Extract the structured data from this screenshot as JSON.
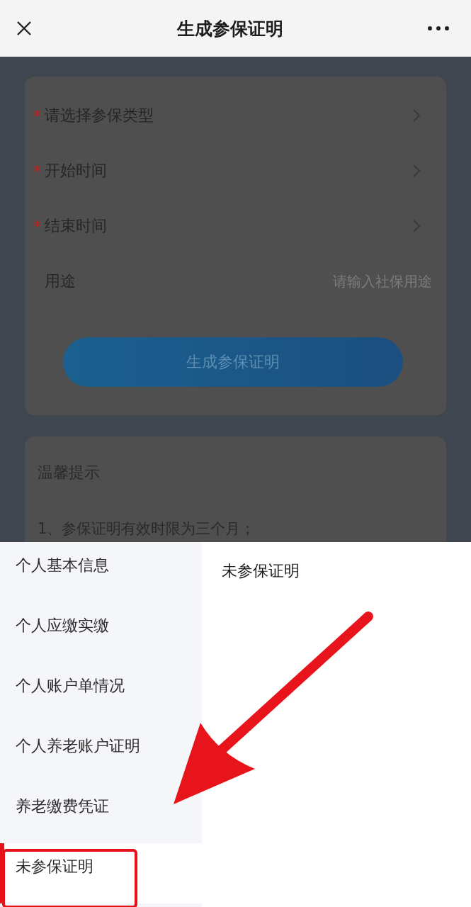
{
  "header": {
    "title": "生成参保证明"
  },
  "form": {
    "rows": [
      {
        "kind": "select",
        "marker": "*",
        "label": "请选择参保类型"
      },
      {
        "kind": "select",
        "marker": "*",
        "label": "开始时间"
      },
      {
        "kind": "select",
        "marker": "*",
        "label": "结束时间"
      },
      {
        "kind": "input",
        "label": "用途",
        "placeholder": "请输入社保用途"
      }
    ],
    "submit": "生成参保证明"
  },
  "tips": {
    "title": "温馨提示",
    "lines": [
      "1、参保证明有效时限为三个月；"
    ]
  },
  "picker": {
    "left": [
      {
        "label": "个人基本信息",
        "selected": false
      },
      {
        "label": "个人应缴实缴",
        "selected": false
      },
      {
        "label": "个人账户单情况",
        "selected": false
      },
      {
        "label": "个人养老账户证明",
        "selected": false
      },
      {
        "label": "养老缴费凭证",
        "selected": false
      },
      {
        "label": "未参保证明",
        "selected": true
      }
    ],
    "right": [
      "未参保证明"
    ]
  }
}
